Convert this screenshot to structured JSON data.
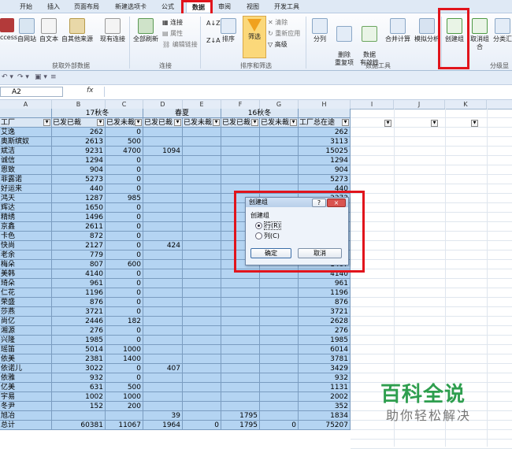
{
  "ribbon": {
    "tabs": [
      "开始",
      "插入",
      "页面布局",
      "新建选项卡",
      "公式",
      "数据",
      "审阅",
      "视图",
      "开发工具"
    ],
    "active_tab": "数据",
    "get_external_data": {
      "buttons": [
        "ccess",
        "自网站",
        "自文本",
        "自其他来源",
        "现有连接"
      ],
      "group_label": "获取外部数据"
    },
    "connections": {
      "refresh_all": "全部刷新",
      "connections": "连接",
      "properties": "属性",
      "edit_links": "编辑链接",
      "group_label": "连接"
    },
    "sort_filter": {
      "sort_az": "A↓Z",
      "sort_za": "Z↓A",
      "sort": "排序",
      "filter": "筛选",
      "clear": "清除",
      "reapply": "重新应用",
      "advanced": "高级",
      "group_label": "排序和筛选"
    },
    "data_tools": {
      "split": "分列",
      "remove_dup": "删除\n重复项",
      "validation": "数据\n有效性",
      "consolidate": "合并计算",
      "whatif": "模拟分析",
      "group_label": "数据工具"
    },
    "outline": {
      "group": "创建组",
      "ungroup": "取消组合",
      "subtotal": "分类汇",
      "group_label": "分级显"
    }
  },
  "formula_bar": {
    "name_box": "A2",
    "fx": "fx",
    "value": ""
  },
  "columns": [
    "A",
    "B",
    "C",
    "D",
    "E",
    "F",
    "G",
    "H",
    "I",
    "J",
    "K"
  ],
  "sheet": {
    "group_headers": [
      "17秋冬",
      "春夏",
      "16秋冬"
    ],
    "col_headers": [
      "工厂",
      "已发已裁",
      "已发未裁",
      "已发已裁",
      "已发未裁",
      "已发已裁",
      "已发未裁",
      "工厂总在途"
    ],
    "rows": [
      [
        "艾逸",
        "262",
        "0",
        "",
        "",
        "",
        "",
        "262"
      ],
      [
        "奥斯缤奴",
        "2613",
        "500",
        "",
        "",
        "",
        "",
        "3113"
      ],
      [
        "斌洁",
        "9231",
        "4700",
        "1094",
        "",
        "",
        "",
        "15025"
      ],
      [
        "诚信",
        "1294",
        "0",
        "",
        "",
        "",
        "",
        "1294"
      ],
      [
        "恩致",
        "904",
        "0",
        "",
        "",
        "",
        "",
        "904"
      ],
      [
        "菲露诺",
        "5273",
        "0",
        "",
        "",
        "",
        "",
        "5273"
      ],
      [
        "好运来",
        "440",
        "0",
        "",
        "",
        "",
        "",
        "440"
      ],
      [
        "鸿天",
        "1287",
        "985",
        "",
        "",
        "",
        "",
        "2272"
      ],
      [
        "辉达",
        "1650",
        "0",
        "",
        "",
        "",
        "",
        "1650"
      ],
      [
        "精绣",
        "1496",
        "0",
        "",
        "",
        "",
        "",
        "1496"
      ],
      [
        "京鑫",
        "2611",
        "0",
        "",
        "",
        "",
        "",
        "2611"
      ],
      [
        "卡色",
        "872",
        "0",
        "",
        "",
        "",
        "",
        "872"
      ],
      [
        "快尚",
        "2127",
        "0",
        "424",
        "",
        "",
        "",
        "2551"
      ],
      [
        "老余",
        "779",
        "0",
        "",
        "",
        "",
        "",
        "779"
      ],
      [
        "梅朵",
        "807",
        "600",
        "",
        "",
        "",
        "",
        "1407"
      ],
      [
        "美韩",
        "4140",
        "0",
        "",
        "",
        "",
        "",
        "4140"
      ],
      [
        "琦朵",
        "961",
        "0",
        "",
        "",
        "",
        "",
        "961"
      ],
      [
        "仁花",
        "1196",
        "0",
        "",
        "",
        "",
        "",
        "1196"
      ],
      [
        "荣盛",
        "876",
        "0",
        "",
        "",
        "",
        "",
        "876"
      ],
      [
        "莎燕",
        "3721",
        "0",
        "",
        "",
        "",
        "",
        "3721"
      ],
      [
        "尚亿",
        "2446",
        "182",
        "",
        "",
        "",
        "",
        "2628"
      ],
      [
        "湘源",
        "276",
        "0",
        "",
        "",
        "",
        "",
        "276"
      ],
      [
        "兴隆",
        "1985",
        "0",
        "",
        "",
        "",
        "",
        "1985"
      ],
      [
        "瑶笛",
        "5014",
        "1000",
        "",
        "",
        "",
        "",
        "6014"
      ],
      [
        "依美",
        "2381",
        "1400",
        "",
        "",
        "",
        "",
        "3781"
      ],
      [
        "依诺儿",
        "3022",
        "0",
        "407",
        "",
        "",
        "",
        "3429"
      ],
      [
        "依雅",
        "932",
        "0",
        "",
        "",
        "",
        "",
        "932"
      ],
      [
        "亿美",
        "631",
        "500",
        "",
        "",
        "",
        "",
        "1131"
      ],
      [
        "宇易",
        "1002",
        "1000",
        "",
        "",
        "",
        "",
        "2002"
      ],
      [
        "冬尹",
        "152",
        "200",
        "",
        "",
        "",
        "",
        "352"
      ],
      [
        "旭冶",
        "",
        "",
        "39",
        "",
        "1795",
        "",
        "1834"
      ],
      [
        "总计",
        "60381",
        "11067",
        "1964",
        "0",
        "1795",
        "0",
        "75207"
      ]
    ]
  },
  "dialog": {
    "title": "创建组",
    "help": "?",
    "close": "×",
    "label": "创建组",
    "option_rows": "行(R)",
    "option_cols": "列(C)",
    "ok": "确定",
    "cancel": "取消"
  },
  "watermark": {
    "line1": "百科全说",
    "line2": "助你轻松解决"
  }
}
